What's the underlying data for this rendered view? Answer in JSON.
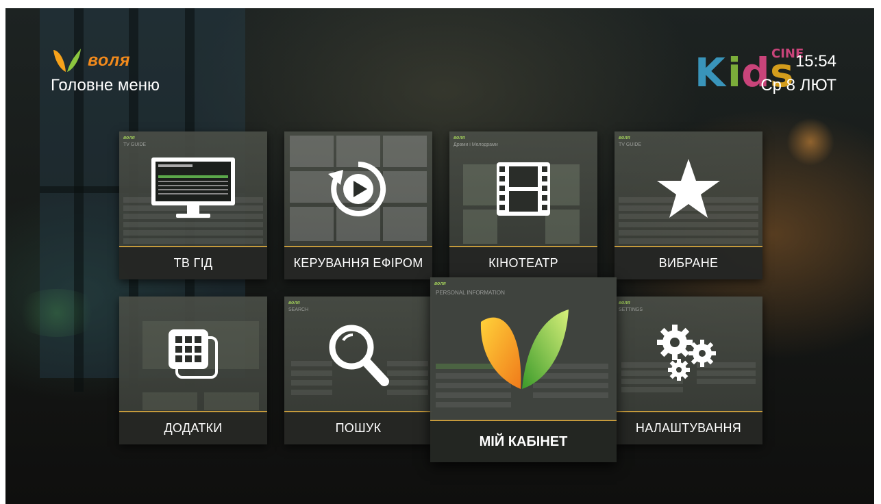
{
  "brand": {
    "name": "воля",
    "color": "#f28a1c",
    "secondary_color": "#8cc63f"
  },
  "header": {
    "title": "Головне меню",
    "time": "15:54",
    "date": "Ср 8 ЛЮТ",
    "channel_logo": {
      "icon": "kids-cine-logo-icon",
      "text_main": "Kids",
      "text_sup": "CINE"
    }
  },
  "tiles": [
    {
      "id": "tv-guide",
      "label": "ТВ ГІД",
      "icon": "monitor-icon",
      "preview_title": "TV GUIDE"
    },
    {
      "id": "broadcast-control",
      "label": "КЕРУВАННЯ ЕФІРОМ",
      "icon": "replay-play-icon",
      "preview_title": ""
    },
    {
      "id": "cinema",
      "label": "КІНОТЕАТР",
      "icon": "film-strip-icon",
      "preview_title": "Драми і Мелодрами"
    },
    {
      "id": "favorites",
      "label": "ВИБРАНЕ",
      "icon": "star-icon",
      "preview_title": "TV GUIDE"
    },
    {
      "id": "apps",
      "label": "ДОДАТКИ",
      "icon": "apps-grid-icon",
      "preview_title": ""
    },
    {
      "id": "search",
      "label": "ПОШУК",
      "icon": "magnifier-icon",
      "preview_title": "SEARCH"
    },
    {
      "id": "my-cabinet",
      "label": "МІЙ КАБІНЕТ",
      "icon": "volia-leaf-logo-icon",
      "preview_title": "PERSONAL INFORMATION",
      "focused": true
    },
    {
      "id": "settings",
      "label": "НАЛАШТУВАННЯ",
      "icon": "gears-icon",
      "preview_title": "SETTINGS"
    }
  ],
  "colors": {
    "accent_line": "#c59a3c",
    "tile_bg": "#3a3e38",
    "label_bg": "#232522"
  }
}
